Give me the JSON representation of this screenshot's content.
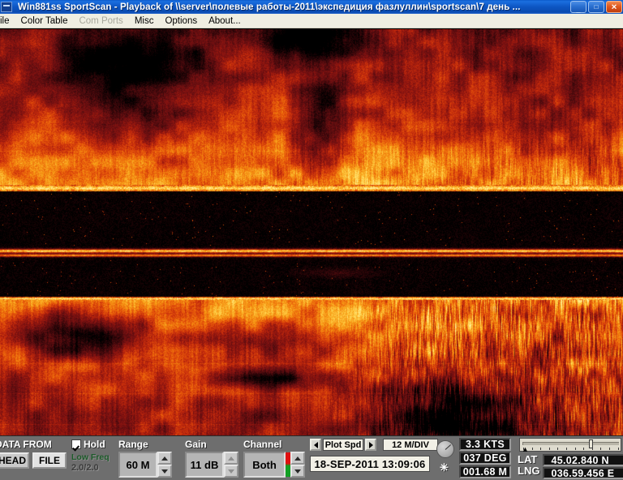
{
  "window": {
    "title": "Win881ss SportScan - Playback of \\\\server\\полевые работы-2011\\экспедиция фазлуллин\\sportscan\\7 день ...",
    "icon": "sonar-app-icon",
    "minimize": "_",
    "maximize": "□",
    "close": "✕"
  },
  "menu": {
    "items": [
      {
        "label": "ile",
        "full_label": "File",
        "disabled": false
      },
      {
        "label": "Color Table",
        "disabled": false
      },
      {
        "label": "Com Ports",
        "disabled": true
      },
      {
        "label": "Misc",
        "disabled": false
      },
      {
        "label": "Options",
        "disabled": false
      },
      {
        "label": "About...",
        "disabled": false
      }
    ]
  },
  "sonar": {
    "description": "side-scan sonar waterfall display",
    "palette": [
      "#000000",
      "#2a0508",
      "#5e0d10",
      "#8c1410",
      "#c42a0c",
      "#e8590a",
      "#f79a14",
      "#ffd24a",
      "#fff0a0"
    ]
  },
  "panel": {
    "data_from": {
      "label": "DATA FROM",
      "buttons": [
        {
          "label": "HEAD",
          "active": false
        },
        {
          "label": "FILE",
          "active": true
        }
      ]
    },
    "hold": {
      "label": "Hold",
      "checked": true,
      "freq_label": "Low Freq",
      "freq_value": "2.0/2.0",
      "freq_color": "#1d5a2a"
    },
    "range": {
      "label": "Range",
      "value": "60 M"
    },
    "gain": {
      "label": "Gain",
      "value": "11 dB"
    },
    "channel": {
      "label": "Channel",
      "value": "Both",
      "strip_top_color": "#e01010",
      "strip_bottom_color": "#12a024"
    },
    "plot": {
      "prev": "◀",
      "mode": "Plot Spd",
      "next": "▶",
      "scale": "12 M/DIV"
    },
    "timestamp": "18-SEP-2011  13:09:06",
    "star": "✳",
    "gauge_name": "heading-gauge",
    "readouts": {
      "speed": "3.3 KTS",
      "heading": "037 DEG",
      "depth": "001.68 M"
    },
    "position": {
      "lat_label": "LAT",
      "lat_value": "45.02.840 N",
      "lng_label": "LNG",
      "lng_value": "036.59.456 E"
    },
    "trackbar": {
      "name": "contrast-slider",
      "position_percent": 72
    }
  }
}
